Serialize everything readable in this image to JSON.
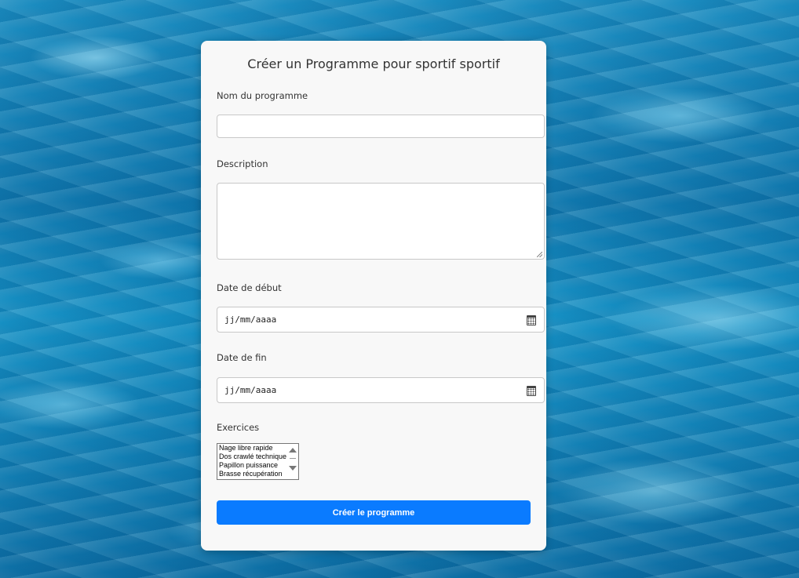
{
  "form": {
    "title": "Créer un Programme pour sportif sportif",
    "name": {
      "label": "Nom du programme",
      "value": ""
    },
    "description": {
      "label": "Description",
      "value": ""
    },
    "start_date": {
      "label": "Date de début",
      "placeholder": "jj/mm/aaaa"
    },
    "end_date": {
      "label": "Date de fin",
      "placeholder": "jj/mm/aaaa"
    },
    "exercises": {
      "label": "Exercices",
      "options": [
        "Nage libre rapide",
        "Dos crawlé technique",
        "Papillon puissance",
        "Brasse récupération"
      ]
    },
    "submit_label": "Créer le programme"
  },
  "icons": {
    "calendar": "calendar-icon",
    "scroll_up": "chevron-up-icon",
    "scroll_down": "chevron-down-icon"
  },
  "colors": {
    "accent": "#0a7bff",
    "card_background": "#f8f8f8",
    "page_background": "#1283bb"
  }
}
